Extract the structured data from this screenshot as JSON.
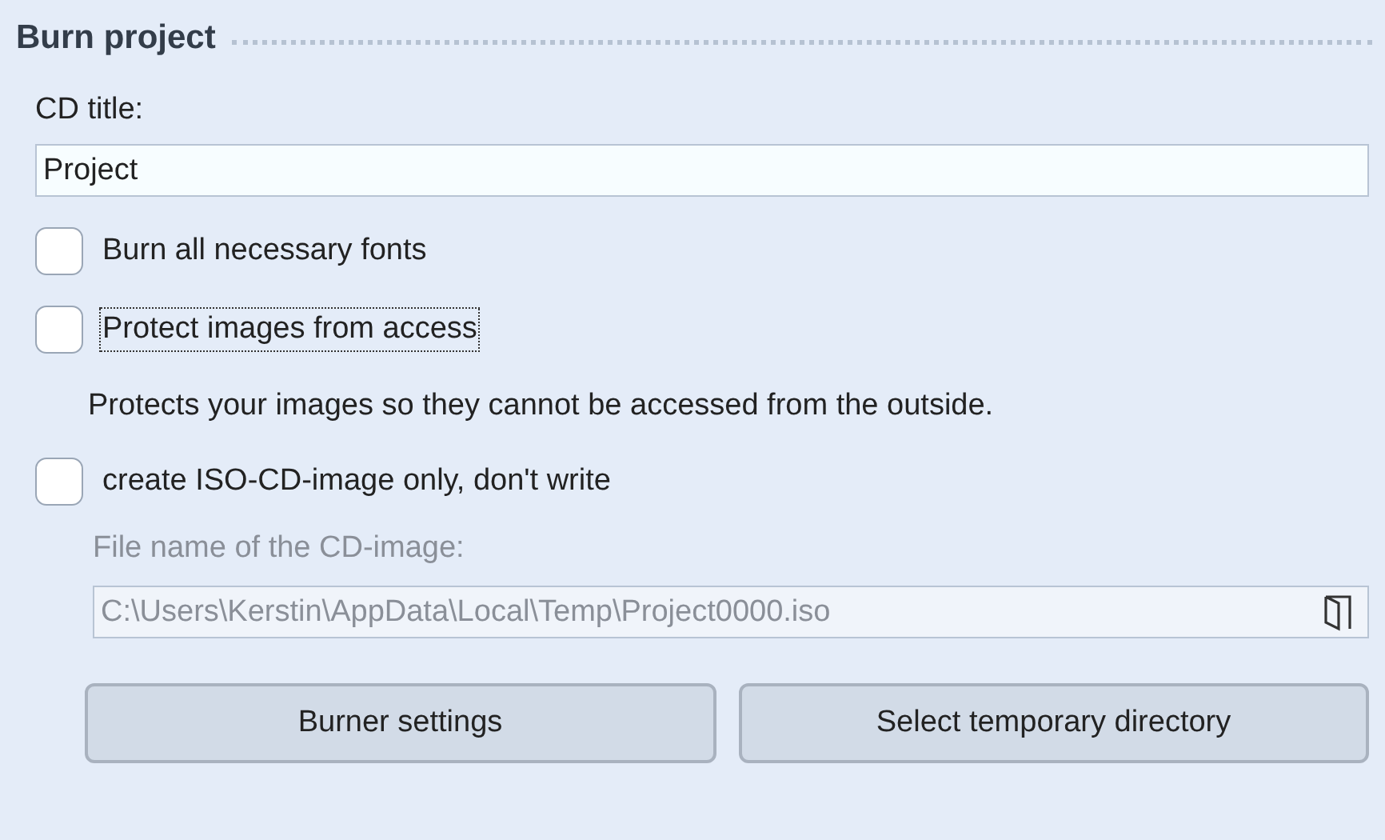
{
  "section": {
    "title": "Burn project"
  },
  "cd_title": {
    "label": "CD title:",
    "value": "Project"
  },
  "options": [
    {
      "label": "Burn all necessary fonts",
      "checked": false,
      "focused": false
    },
    {
      "label": "Protect images from access",
      "checked": false,
      "focused": true,
      "description": "Protects your images so they cannot be accessed from the outside."
    },
    {
      "label": "create ISO-CD-image only, don't write",
      "checked": false,
      "focused": false
    }
  ],
  "image_file": {
    "label": "File name of the CD-image:",
    "value": "C:\\Users\\Kerstin\\AppData\\Local\\Temp\\Project0000.iso",
    "disabled": true
  },
  "buttons": [
    "Burner settings",
    "Select temporary directory"
  ]
}
